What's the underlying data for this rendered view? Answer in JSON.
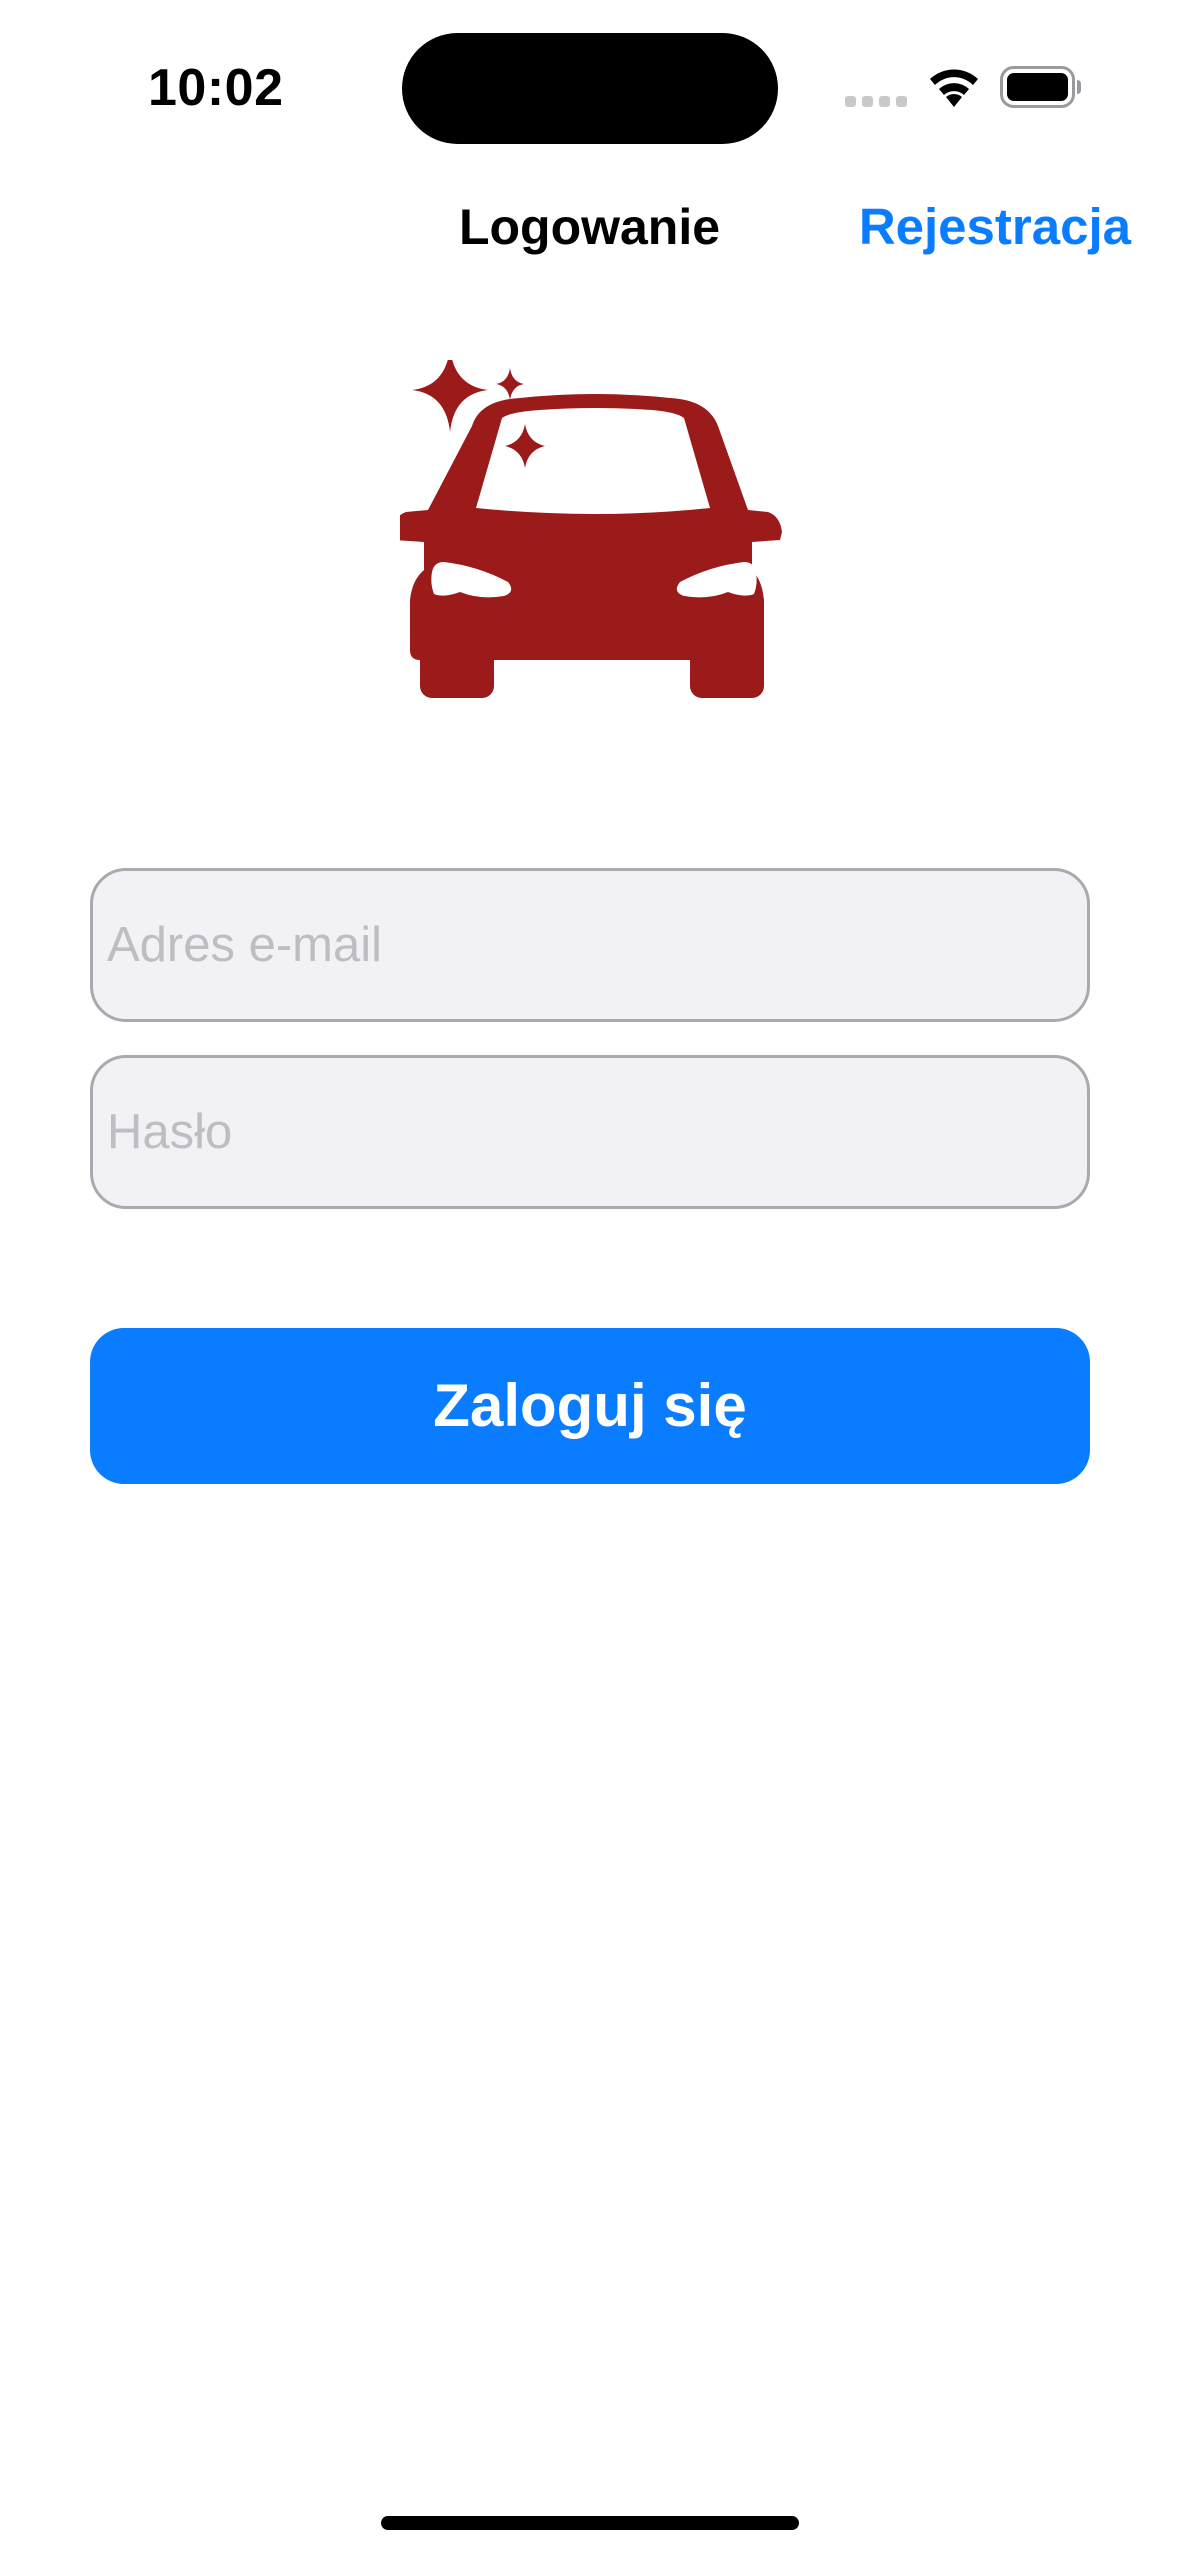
{
  "status_bar": {
    "time": "10:02",
    "icons": [
      "cellular-signal-icon",
      "wifi-icon",
      "battery-icon"
    ]
  },
  "nav": {
    "title": "Logowanie",
    "register_label": "Rejestracja"
  },
  "logo": {
    "icon": "car-sparkle-icon",
    "color": "#9b1b1b"
  },
  "form": {
    "email": {
      "placeholder": "Adres e-mail",
      "value": ""
    },
    "password": {
      "placeholder": "Hasło",
      "value": ""
    },
    "login_label": "Zaloguj się"
  },
  "colors": {
    "accent": "#0a7cff",
    "field_background": "#f1f1f6",
    "field_border": "#a9a9ae",
    "placeholder": "#bdbdc2"
  }
}
